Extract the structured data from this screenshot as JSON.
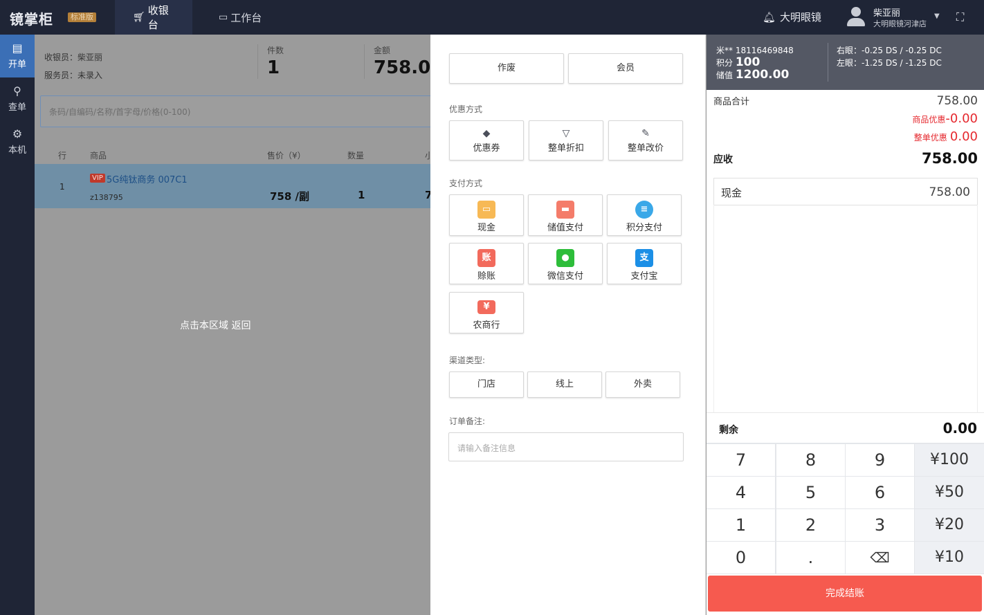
{
  "topbar": {
    "brand": "镜掌柜",
    "edition": "标准版",
    "nav": [
      {
        "label": "收银台"
      },
      {
        "label": "工作台"
      }
    ],
    "shop": "大明眼镜",
    "user_name": "柴亚丽",
    "user_store": "大明眼镜河津店"
  },
  "sidebar": {
    "items": [
      {
        "label": "开单"
      },
      {
        "label": "查单"
      },
      {
        "label": "本机"
      }
    ]
  },
  "order": {
    "cashier": "收银员：柴亚丽",
    "staff": "服务员：未录入",
    "count_label": "件数",
    "count_value": "1",
    "amount_label": "金额",
    "amount_value": "758.00",
    "search_placeholder": "条码/自编码/名称/首字母/价格(0-100)",
    "columns": [
      "行",
      "商品",
      "售价（¥）",
      "数量",
      "小"
    ],
    "rows": [
      {
        "idx": "1",
        "vip": "VIP",
        "name": "5G纯钛商务 007C1",
        "code": "z138795",
        "price": "758 /副",
        "qty": "1",
        "subtotal": "7"
      }
    ],
    "back_hint": "点击本区域 返回"
  },
  "actions": {
    "void": "作废",
    "member": "会员",
    "discount_title": "优惠方式",
    "discounts": [
      {
        "label": "优惠券"
      },
      {
        "label": "整单折扣"
      },
      {
        "label": "整单改价"
      }
    ],
    "pay_title": "支付方式",
    "payments": [
      {
        "label": "现金"
      },
      {
        "label": "储值支付"
      },
      {
        "label": "积分支付"
      },
      {
        "label": "赊账"
      },
      {
        "label": "微信支付"
      },
      {
        "label": "支付宝"
      },
      {
        "label": "农商行"
      }
    ],
    "channel_title": "渠道类型:",
    "channels": [
      {
        "label": "门店"
      },
      {
        "label": "线上"
      },
      {
        "label": "外卖"
      }
    ],
    "note_title": "订单备注:",
    "note_placeholder": "请输入备注信息"
  },
  "member": {
    "phone": "米** 18116469848",
    "points_label": "积分",
    "points": "100",
    "balance_label": "储值",
    "balance": "1200.00",
    "right_eye": "右眼：-0.25 DS / -0.25 DC",
    "left_eye": "左眼：-1.25 DS / -1.25 DC"
  },
  "summary": {
    "total_label": "商品合计",
    "total": "758.00",
    "item_disc_label": "商品优惠",
    "item_disc": "-0.00",
    "order_disc_label": "整单优惠",
    "order_disc": "0.00",
    "due_label": "应收",
    "due": "758.00",
    "cash_label": "现金",
    "cash": "758.00",
    "remain_label": "剩余",
    "remain": "0.00"
  },
  "keypad": {
    "keys": [
      "7",
      "8",
      "9",
      "¥100",
      "4",
      "5",
      "6",
      "¥50",
      "1",
      "2",
      "3",
      "¥20",
      "0",
      ".",
      "⌫",
      "¥10"
    ]
  },
  "finish_label": "完成结账",
  "colors": {
    "topbar": "#1f2536",
    "active_side": "#3b6fb6",
    "finish": "#f65a4f",
    "discount_red": "#e5282e"
  }
}
